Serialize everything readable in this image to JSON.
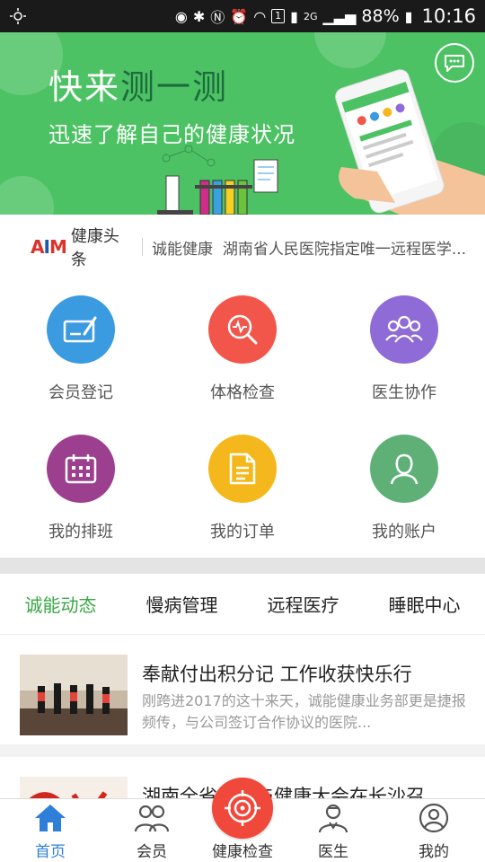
{
  "status_bar": {
    "battery": "88%",
    "time": "10:16",
    "sim": "1",
    "network": "2G"
  },
  "banner": {
    "title_part1": "快来",
    "title_part2": "测一测",
    "subtitle": "迅速了解自己的健康状况"
  },
  "ticker": {
    "logo_text": "健康头条",
    "source": "诚能健康",
    "headline": "湖南省人民医院指定唯一远程医学..."
  },
  "features": [
    {
      "label": "会员登记",
      "icon": "member-register-icon",
      "color": "#3a9be0"
    },
    {
      "label": "体格检查",
      "icon": "physical-exam-icon",
      "color": "#f2564a"
    },
    {
      "label": "医生协作",
      "icon": "doctor-collab-icon",
      "color": "#8e6bd6"
    },
    {
      "label": "我的排班",
      "icon": "schedule-icon",
      "color": "#9d3f8f"
    },
    {
      "label": "我的订单",
      "icon": "order-icon",
      "color": "#f5b81c"
    },
    {
      "label": "我的账户",
      "icon": "account-icon",
      "color": "#5fb077"
    }
  ],
  "tabs": [
    {
      "label": "诚能动态",
      "active": true
    },
    {
      "label": "慢病管理",
      "active": false
    },
    {
      "label": "远程医疗",
      "active": false
    },
    {
      "label": "睡眠中心",
      "active": false
    }
  ],
  "articles": [
    {
      "title": "奉献付出积分记 工作收获快乐行",
      "summary": "刚跨进2017的这十来天，诚能健康业务部更是捷报频传，与公司签订合作协议的医院..."
    },
    {
      "title": "湖南全省卫生与健康大会在长沙召...",
      "summary": ""
    }
  ],
  "bottom_nav": [
    {
      "label": "首页",
      "icon": "home-icon",
      "active": true
    },
    {
      "label": "会员",
      "icon": "members-icon",
      "active": false
    },
    {
      "label": "健康检查",
      "icon": "target-icon",
      "active": false
    },
    {
      "label": "医生",
      "icon": "doctor-icon",
      "active": false
    },
    {
      "label": "我的",
      "icon": "profile-icon",
      "active": false
    }
  ],
  "colors": {
    "brand_green": "#4dc264",
    "active_tab": "#3aa846",
    "active_nav": "#2f7fd9",
    "center_button": "#f0483a"
  }
}
